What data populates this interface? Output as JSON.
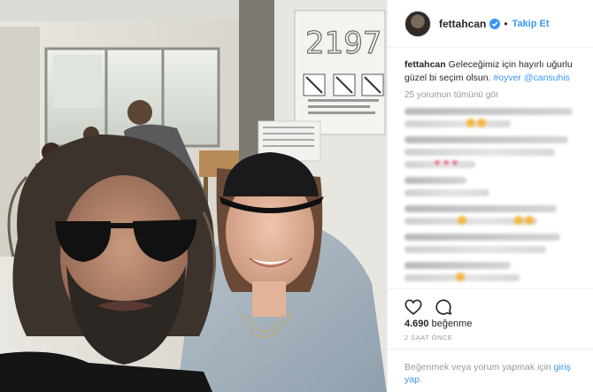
{
  "post": {
    "username": "fettahcan",
    "follow_label": "Takip Et",
    "separator": "•",
    "caption": {
      "username": "fettahcan",
      "text": " Geleceğimiz için hayırlı uğurlu güzel bi seçim olsun. ",
      "hashtag": "#oyver",
      "mention": "@cansuhis"
    },
    "view_all_comments": "25 yorumun tümünü gör",
    "likes_count": "4.690",
    "likes_label": " beğenme",
    "time_ago": "2 SAAT ÖNCE",
    "footer": {
      "prefix": "Beğenmek veya yorum yapmak için ",
      "login_link": "giriş yap",
      "suffix": "."
    }
  },
  "photo": {
    "door_sign_number": "2197"
  },
  "colors": {
    "accent_blue": "#3897f0",
    "muted_gray": "#999999",
    "text": "#262626"
  },
  "icons": [
    "verified-badge-icon",
    "heart-icon",
    "comment-icon"
  ]
}
